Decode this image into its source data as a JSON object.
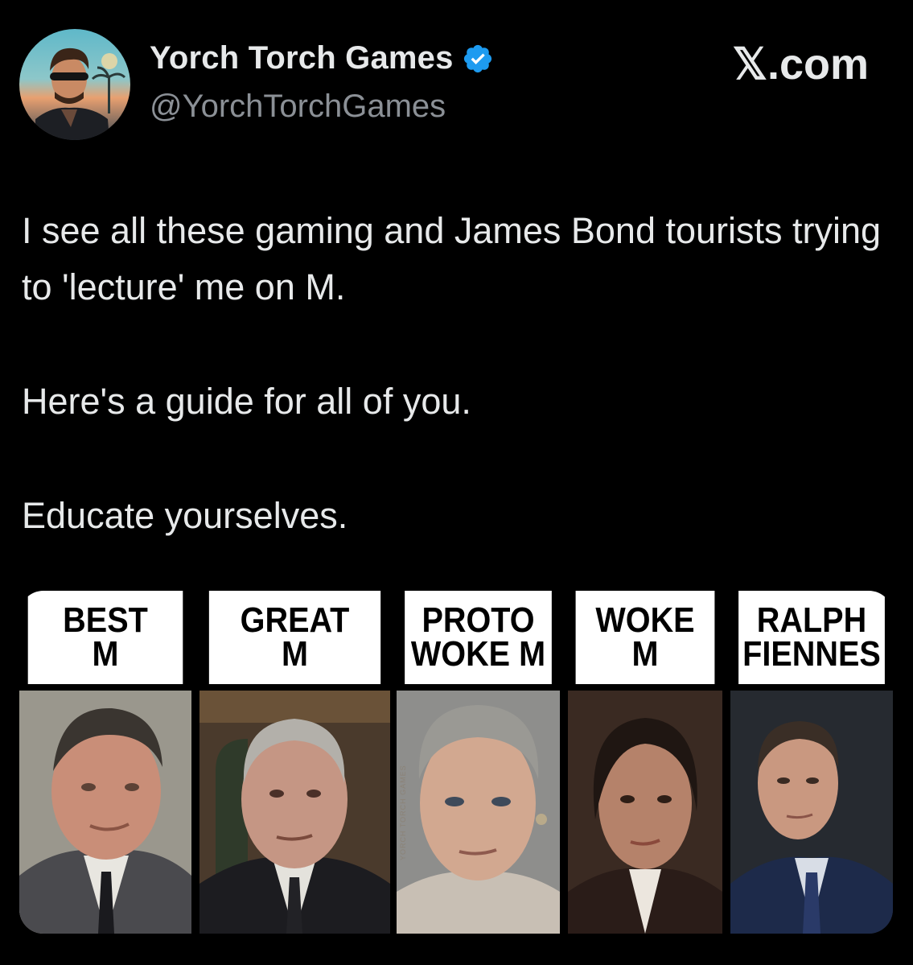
{
  "author": {
    "name": "Yorch Torch Games",
    "handle": "@YorchTorchGames",
    "verified": true,
    "avatar_icon": "avatar-illustration-icon"
  },
  "brand": "𝕏.com",
  "tweet": {
    "paragraphs": [
      "I see all these gaming and James Bond tourists trying to 'lecture' me on M.",
      "Here's a guide for all of you.",
      "Educate yourselves."
    ]
  },
  "media": {
    "panels": [
      {
        "line1": "BEST",
        "line2": "M"
      },
      {
        "line1": "GREAT",
        "line2": "M"
      },
      {
        "line1": "PROTO",
        "line2": "WOKE M"
      },
      {
        "line1": "WOKE",
        "line2": "M"
      },
      {
        "line1": "RALPH",
        "line2": "FIENNES"
      }
    ],
    "watermark": "YORCH TORCH GAMES"
  },
  "colors": {
    "background": "#000000",
    "text": "#e7e9ea",
    "secondary": "#8b9096",
    "verified": "#1d9bf0"
  }
}
